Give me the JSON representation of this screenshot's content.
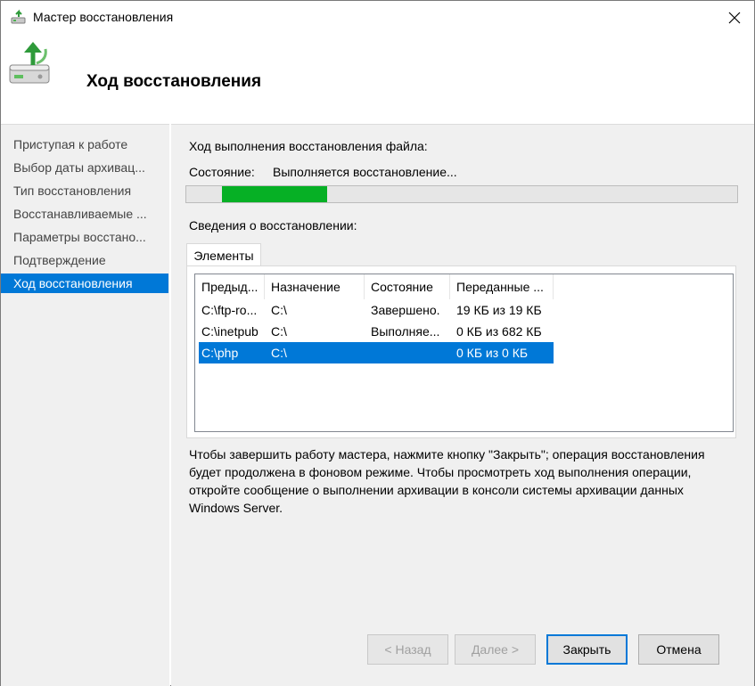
{
  "window": {
    "title": "Мастер восстановления",
    "close_label": "×"
  },
  "header": {
    "title": "Ход восстановления"
  },
  "sidebar": {
    "items": [
      {
        "label": "Приступая к работе"
      },
      {
        "label": "Выбор даты архивац..."
      },
      {
        "label": "Тип восстановления"
      },
      {
        "label": "Восстанавливаемые ..."
      },
      {
        "label": "Параметры восстано..."
      },
      {
        "label": "Подтверждение"
      },
      {
        "label": "Ход восстановления"
      }
    ],
    "active_index": 6
  },
  "main": {
    "progress_heading": "Ход выполнения восстановления файла:",
    "status_label": "Состояние:",
    "status_value": "Выполняется восстановление...",
    "progress": {
      "fill_fraction": 0.205,
      "color": "#06b025"
    },
    "details_heading": "Сведения о восстановлении:",
    "tab_label": "Элементы",
    "table": {
      "columns": [
        "Предыд...",
        "Назначение",
        "Состояние",
        "Переданные ..."
      ],
      "rows": [
        {
          "source": "C:\\ftp-ro...",
          "destination": "C:\\",
          "state": "Завершено.",
          "transferred": "19 КБ из 19 КБ",
          "selected": false
        },
        {
          "source": "C:\\inetpub",
          "destination": "C:\\",
          "state": "Выполняе...",
          "transferred": "0 КБ из 682 КБ",
          "selected": false
        },
        {
          "source": "C:\\php",
          "destination": "C:\\",
          "state": "",
          "transferred": "0 КБ из 0 КБ",
          "selected": true
        }
      ]
    },
    "info_text": "Чтобы завершить работу мастера, нажмите кнопку \"Закрыть\"; операция восстановления будет продолжена в фоновом режиме. Чтобы просмотреть ход выполнения операции, откройте сообщение о выполнении архивации в консоли системы архивации данных Windows Server."
  },
  "buttons": {
    "back": "< Назад",
    "next": "Далее >",
    "close": "Закрыть",
    "cancel": "Отмена"
  },
  "colors": {
    "accent": "#0078d7",
    "progress_fill": "#06b025",
    "panel_bg": "#f0f0f0"
  },
  "icons": {
    "title": "restore-wizard-icon",
    "header": "backup-restore-icon",
    "close": "close-icon"
  }
}
